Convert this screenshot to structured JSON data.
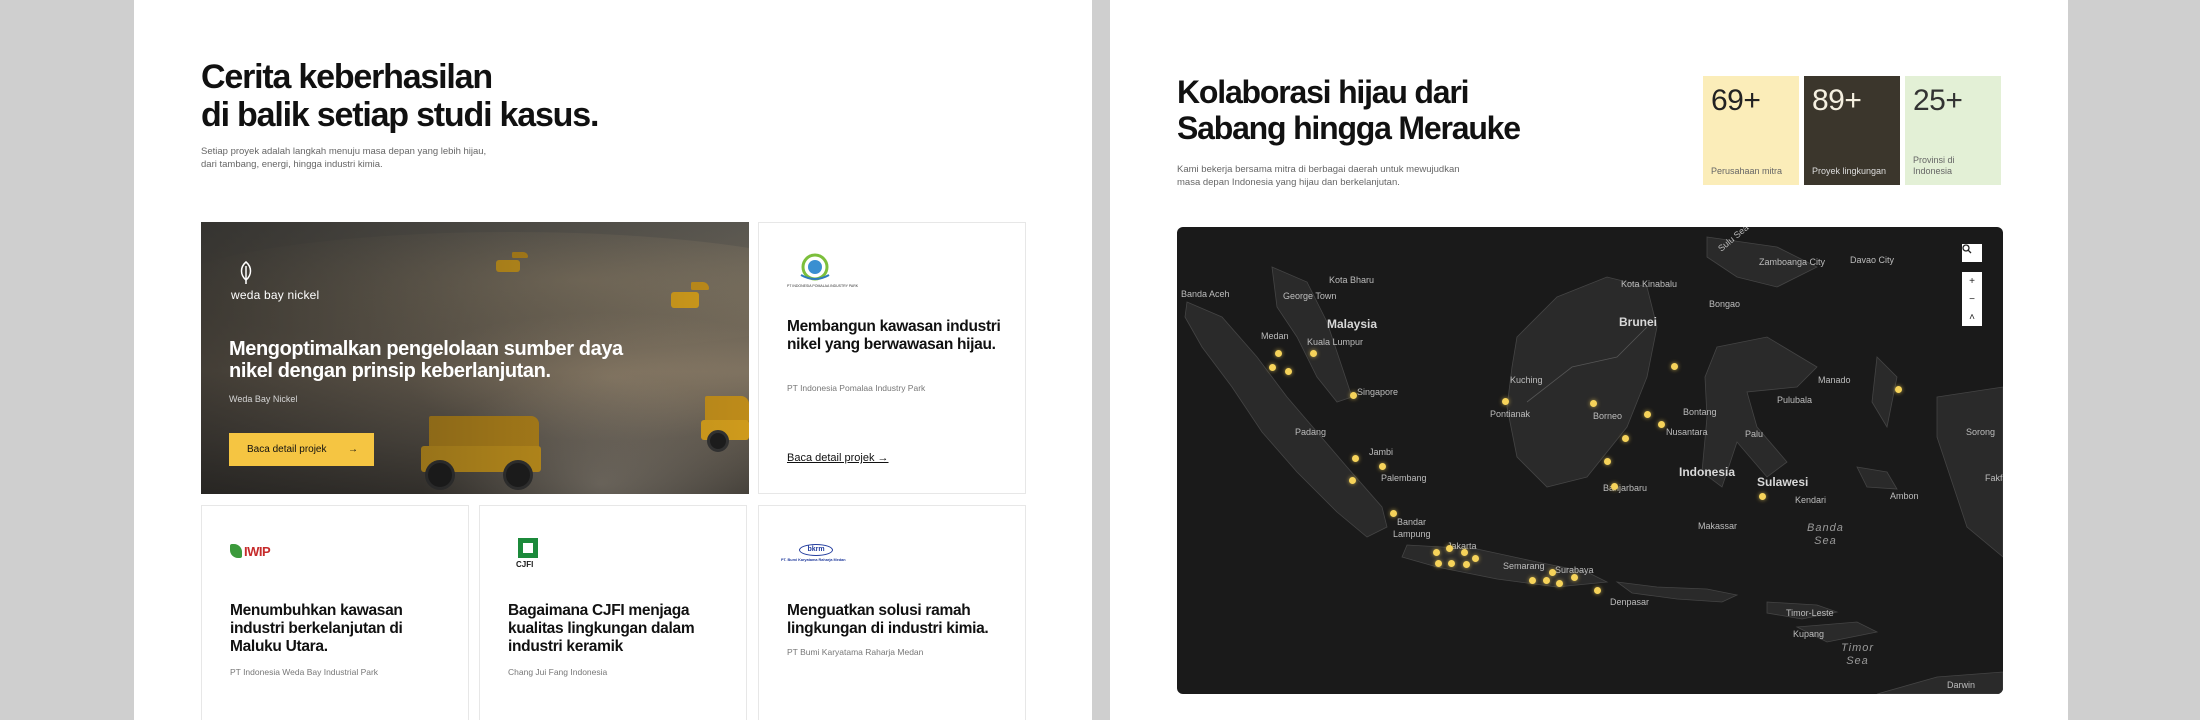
{
  "case_studies": {
    "heading_line1": "Cerita keberhasilan",
    "heading_line2": "di balik setiap studi kasus.",
    "subtitle_line1": "Setiap proyek adalah langkah menuju masa depan yang lebih hijau,",
    "subtitle_line2": "dari tambang, energi, hingga industri kimia.",
    "featured": {
      "logo_text": "weda bay nickel",
      "logo_icon": "leaf-icon",
      "title": "Mengoptimalkan pengelolaan sumber daya nikel dengan prinsip keberlanjutan.",
      "organization": "Weda Bay Nickel",
      "button_label": "Baca detail projek",
      "button_icon": "arrow-right-icon",
      "button_color": "#f5c542"
    },
    "cards": [
      {
        "logo_caption": "PT INDONESIA POMALAA INDUSTRY PARK",
        "title": "Membangun kawasan industri nikel yang berwawasan hijau.",
        "organization": "PT Indonesia Pomalaa Industry Park",
        "link_label": "Baca detail projek →"
      },
      {
        "logo_text": "IWIP",
        "title": "Menumbuhkan kawasan industri berkelanjutan di Maluku Utara.",
        "organization": "PT Indonesia Weda Bay Industrial Park"
      },
      {
        "logo_text": "CJFI",
        "title": "Bagaimana CJFI menjaga kualitas lingkungan dalam industri keramik",
        "organization": "Chang Jui Fang Indonesia"
      },
      {
        "logo_text": "bkrm",
        "logo_caption": "PT. Bumi Karyatama Raharja Medan",
        "title": "Menguatkan solusi ramah lingkungan di industri kimia.",
        "organization": "PT Bumi Karyatama Raharja Medan"
      }
    ]
  },
  "collaboration": {
    "heading_line1": "Kolaborasi hijau dari",
    "heading_line2": "Sabang hingga Merauke",
    "subtitle_line1": "Kami bekerja bersama mitra di berbagai daerah untuk mewujudkan",
    "subtitle_line2": "masa depan Indonesia yang hijau dan berkelanjutan.",
    "stats": [
      {
        "value": "69+",
        "label": "Perusahaan mitra",
        "color": "#fbedb9"
      },
      {
        "value": "89+",
        "label": "Proyek lingkungan",
        "color": "#3b362c"
      },
      {
        "value": "25+",
        "label": "Provinsi di Indonesia",
        "color": "#e3f0d6"
      }
    ],
    "map": {
      "controls": {
        "search_icon": "search-icon",
        "zoom_in": "+",
        "zoom_out": "−",
        "reset": "˄"
      },
      "marker_color": "#f6d35a",
      "labels": {
        "sulu_sea": "Sulu Sea",
        "zamboanga": "Zamboanga City",
        "davao": "Davao City",
        "banda_aceh": "Banda Aceh",
        "kota_bharu": "Kota Bharu",
        "kota_kinabalu": "Kota Kinabalu",
        "george_town": "George Town",
        "bongao": "Bongao",
        "malaysia": "Malaysia",
        "brunei": "Brunei",
        "medan": "Medan",
        "kuala_lumpur": "Kuala Lumpur",
        "singapore": "Singapore",
        "kuching": "Kuching",
        "manado": "Manado",
        "pontianak": "Pontianak",
        "borneo": "Borneo",
        "bontang": "Bontang",
        "nusantara": "Nusantara",
        "palu": "Palu",
        "pulubala": "Pulubala",
        "sorong": "Sorong",
        "padang": "Padang",
        "jambi": "Jambi",
        "indonesia": "Indonesia",
        "fakfak": "Fakfak",
        "palembang": "Palembang",
        "banjarbaru": "Banjarbaru",
        "sulawesi": "Sulawesi",
        "kendari": "Kendari",
        "ambon": "Ambon",
        "bandar_lampung_1": "Bandar",
        "bandar_lampung_2": "Lampung",
        "makassar": "Makassar",
        "jakarta": "Jakarta",
        "banda_sea_1": "Banda",
        "banda_sea_2": "Sea",
        "semarang": "Semarang",
        "surabaya": "Surabaya",
        "denpasar": "Denpasar",
        "timor_leste": "Timor-Leste",
        "kupang": "Kupang",
        "timor_sea_1": "Timor",
        "timor_sea_2": "Sea",
        "darwin": "Darwin"
      }
    }
  }
}
